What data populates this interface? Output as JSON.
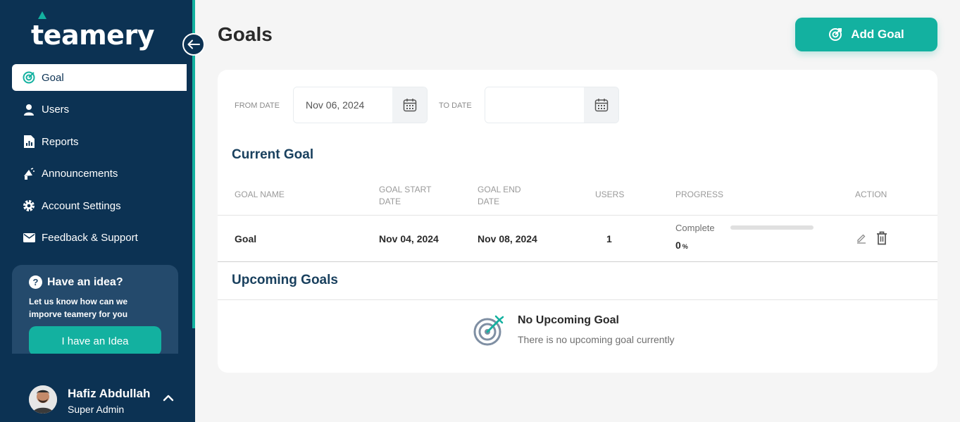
{
  "sidebar": {
    "logo_text": "teamery",
    "items": [
      {
        "label": "Goal",
        "icon": "goal-icon",
        "active": true
      },
      {
        "label": "Users",
        "icon": "users-icon"
      },
      {
        "label": "Reports",
        "icon": "reports-icon"
      },
      {
        "label": "Announcements",
        "icon": "announcement-icon"
      },
      {
        "label": "Account Settings",
        "icon": "gear-icon"
      },
      {
        "label": "Feedback & Support",
        "icon": "mail-icon"
      }
    ],
    "idea": {
      "title": "Have an idea?",
      "description": "Let us know how can we imporve teamery for you",
      "button_label": "I have an Idea"
    },
    "user": {
      "name": "Hafiz Abdullah",
      "role": "Super Admin"
    }
  },
  "header": {
    "title": "Goals",
    "add_goal_label": "Add Goal"
  },
  "filters": {
    "from_label": "FROM DATE",
    "from_value": "Nov 06, 2024",
    "to_label": "TO DATE",
    "to_value": ""
  },
  "current_goals": {
    "title": "Current Goal",
    "columns": {
      "name": "GOAL NAME",
      "start": "GOAL START DATE",
      "end": "GOAL END DATE",
      "users": "USERS",
      "progress": "PROGRESS",
      "action": "ACTION"
    },
    "rows": [
      {
        "name": "Goal",
        "start": "Nov 04, 2024",
        "end": "Nov 08, 2024",
        "users": "1",
        "progress_label": "Complete",
        "progress_value": "0",
        "progress_unit": "%",
        "progress_fraction": 0
      }
    ]
  },
  "upcoming_goals": {
    "title": "Upcoming Goals",
    "empty_title": "No Upcoming Goal",
    "empty_text": "There is no upcoming goal currently"
  },
  "colors": {
    "primary": "#13b1a0",
    "sidebar": "#0c3253",
    "idea_card": "#244a6c"
  }
}
